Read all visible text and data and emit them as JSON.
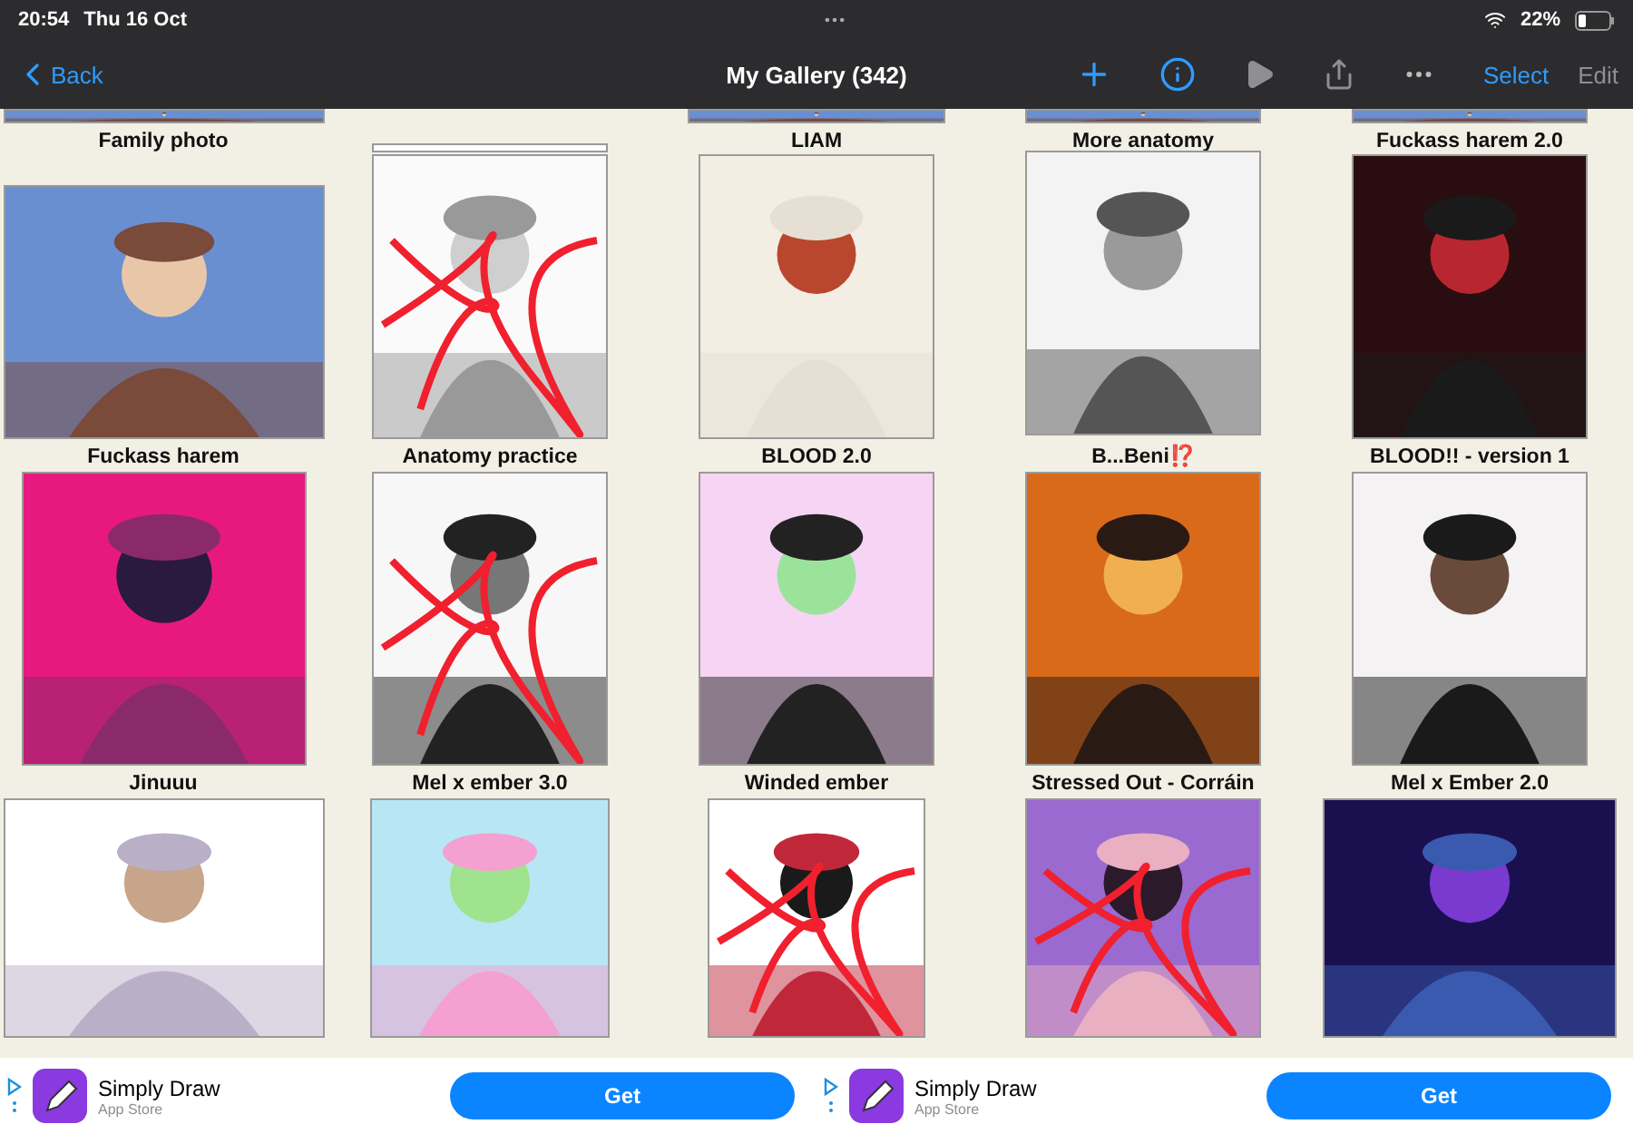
{
  "status_bar": {
    "time": "20:54",
    "date": "Thu 16 Oct",
    "battery": "22%"
  },
  "nav": {
    "back": "Back",
    "title": "My Gallery (342)",
    "select": "Select",
    "edit": {
      "label": "Edit",
      "disabled": true
    }
  },
  "rows": [
    {
      "items": [
        {
          "title": "Family photo"
        },
        {
          "kind": "picture"
        },
        {
          "title": "LIAM"
        },
        {
          "title": "More anatomy"
        },
        {
          "title": "Fuckass harem 2.0"
        }
      ]
    },
    {
      "items": [
        {
          "title": "Fuckass harem"
        },
        {
          "title": "Anatomy practice"
        },
        {
          "title": "BLOOD 2.0"
        },
        {
          "title": "B...Beni⁉️"
        },
        {
          "title": "BLOOD!! - version 1"
        }
      ]
    },
    {
      "items": [
        {
          "title": "Jinuuu"
        },
        {
          "title": "Mel x ember 3.0"
        },
        {
          "title": "Winded ember"
        },
        {
          "title": "Stressed Out - Corráin"
        },
        {
          "title": "Mel x Ember 2.0"
        }
      ]
    },
    {
      "items": [
        {
          "kind": "picture"
        },
        {
          "kind": "picture"
        },
        {
          "kind": "picture"
        },
        {
          "kind": "picture"
        },
        {
          "kind": "picture"
        }
      ]
    }
  ],
  "ads": [
    {
      "name": "Simply Draw",
      "source": "App Store",
      "button": "Get"
    },
    {
      "name": "Simply Draw",
      "source": "App Store",
      "button": "Get"
    }
  ]
}
